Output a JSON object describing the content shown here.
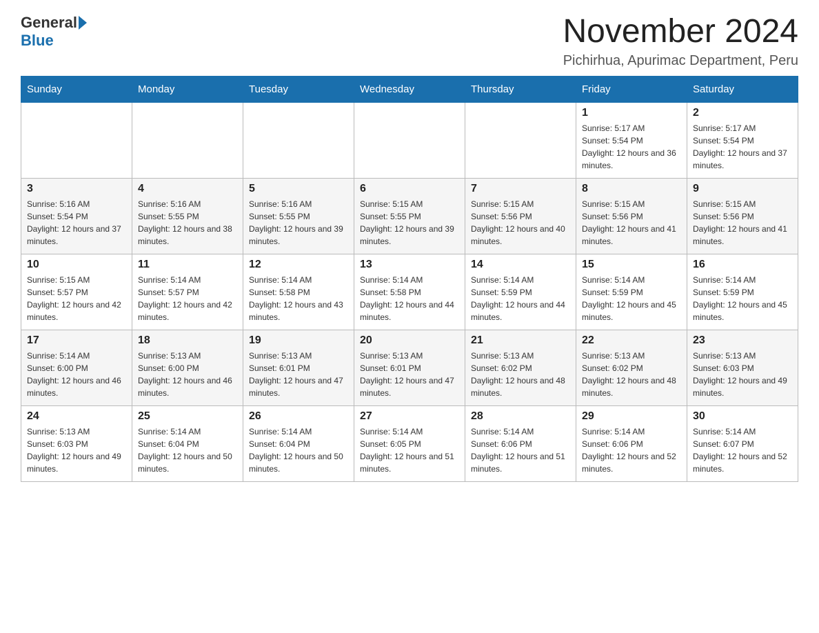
{
  "header": {
    "logo_general": "General",
    "logo_blue": "Blue",
    "month_title": "November 2024",
    "location": "Pichirhua, Apurimac Department, Peru"
  },
  "weekdays": [
    "Sunday",
    "Monday",
    "Tuesday",
    "Wednesday",
    "Thursday",
    "Friday",
    "Saturday"
  ],
  "weeks": [
    [
      {
        "day": "",
        "sunrise": "",
        "sunset": "",
        "daylight": ""
      },
      {
        "day": "",
        "sunrise": "",
        "sunset": "",
        "daylight": ""
      },
      {
        "day": "",
        "sunrise": "",
        "sunset": "",
        "daylight": ""
      },
      {
        "day": "",
        "sunrise": "",
        "sunset": "",
        "daylight": ""
      },
      {
        "day": "",
        "sunrise": "",
        "sunset": "",
        "daylight": ""
      },
      {
        "day": "1",
        "sunrise": "Sunrise: 5:17 AM",
        "sunset": "Sunset: 5:54 PM",
        "daylight": "Daylight: 12 hours and 36 minutes."
      },
      {
        "day": "2",
        "sunrise": "Sunrise: 5:17 AM",
        "sunset": "Sunset: 5:54 PM",
        "daylight": "Daylight: 12 hours and 37 minutes."
      }
    ],
    [
      {
        "day": "3",
        "sunrise": "Sunrise: 5:16 AM",
        "sunset": "Sunset: 5:54 PM",
        "daylight": "Daylight: 12 hours and 37 minutes."
      },
      {
        "day": "4",
        "sunrise": "Sunrise: 5:16 AM",
        "sunset": "Sunset: 5:55 PM",
        "daylight": "Daylight: 12 hours and 38 minutes."
      },
      {
        "day": "5",
        "sunrise": "Sunrise: 5:16 AM",
        "sunset": "Sunset: 5:55 PM",
        "daylight": "Daylight: 12 hours and 39 minutes."
      },
      {
        "day": "6",
        "sunrise": "Sunrise: 5:15 AM",
        "sunset": "Sunset: 5:55 PM",
        "daylight": "Daylight: 12 hours and 39 minutes."
      },
      {
        "day": "7",
        "sunrise": "Sunrise: 5:15 AM",
        "sunset": "Sunset: 5:56 PM",
        "daylight": "Daylight: 12 hours and 40 minutes."
      },
      {
        "day": "8",
        "sunrise": "Sunrise: 5:15 AM",
        "sunset": "Sunset: 5:56 PM",
        "daylight": "Daylight: 12 hours and 41 minutes."
      },
      {
        "day": "9",
        "sunrise": "Sunrise: 5:15 AM",
        "sunset": "Sunset: 5:56 PM",
        "daylight": "Daylight: 12 hours and 41 minutes."
      }
    ],
    [
      {
        "day": "10",
        "sunrise": "Sunrise: 5:15 AM",
        "sunset": "Sunset: 5:57 PM",
        "daylight": "Daylight: 12 hours and 42 minutes."
      },
      {
        "day": "11",
        "sunrise": "Sunrise: 5:14 AM",
        "sunset": "Sunset: 5:57 PM",
        "daylight": "Daylight: 12 hours and 42 minutes."
      },
      {
        "day": "12",
        "sunrise": "Sunrise: 5:14 AM",
        "sunset": "Sunset: 5:58 PM",
        "daylight": "Daylight: 12 hours and 43 minutes."
      },
      {
        "day": "13",
        "sunrise": "Sunrise: 5:14 AM",
        "sunset": "Sunset: 5:58 PM",
        "daylight": "Daylight: 12 hours and 44 minutes."
      },
      {
        "day": "14",
        "sunrise": "Sunrise: 5:14 AM",
        "sunset": "Sunset: 5:59 PM",
        "daylight": "Daylight: 12 hours and 44 minutes."
      },
      {
        "day": "15",
        "sunrise": "Sunrise: 5:14 AM",
        "sunset": "Sunset: 5:59 PM",
        "daylight": "Daylight: 12 hours and 45 minutes."
      },
      {
        "day": "16",
        "sunrise": "Sunrise: 5:14 AM",
        "sunset": "Sunset: 5:59 PM",
        "daylight": "Daylight: 12 hours and 45 minutes."
      }
    ],
    [
      {
        "day": "17",
        "sunrise": "Sunrise: 5:14 AM",
        "sunset": "Sunset: 6:00 PM",
        "daylight": "Daylight: 12 hours and 46 minutes."
      },
      {
        "day": "18",
        "sunrise": "Sunrise: 5:13 AM",
        "sunset": "Sunset: 6:00 PM",
        "daylight": "Daylight: 12 hours and 46 minutes."
      },
      {
        "day": "19",
        "sunrise": "Sunrise: 5:13 AM",
        "sunset": "Sunset: 6:01 PM",
        "daylight": "Daylight: 12 hours and 47 minutes."
      },
      {
        "day": "20",
        "sunrise": "Sunrise: 5:13 AM",
        "sunset": "Sunset: 6:01 PM",
        "daylight": "Daylight: 12 hours and 47 minutes."
      },
      {
        "day": "21",
        "sunrise": "Sunrise: 5:13 AM",
        "sunset": "Sunset: 6:02 PM",
        "daylight": "Daylight: 12 hours and 48 minutes."
      },
      {
        "day": "22",
        "sunrise": "Sunrise: 5:13 AM",
        "sunset": "Sunset: 6:02 PM",
        "daylight": "Daylight: 12 hours and 48 minutes."
      },
      {
        "day": "23",
        "sunrise": "Sunrise: 5:13 AM",
        "sunset": "Sunset: 6:03 PM",
        "daylight": "Daylight: 12 hours and 49 minutes."
      }
    ],
    [
      {
        "day": "24",
        "sunrise": "Sunrise: 5:13 AM",
        "sunset": "Sunset: 6:03 PM",
        "daylight": "Daylight: 12 hours and 49 minutes."
      },
      {
        "day": "25",
        "sunrise": "Sunrise: 5:14 AM",
        "sunset": "Sunset: 6:04 PM",
        "daylight": "Daylight: 12 hours and 50 minutes."
      },
      {
        "day": "26",
        "sunrise": "Sunrise: 5:14 AM",
        "sunset": "Sunset: 6:04 PM",
        "daylight": "Daylight: 12 hours and 50 minutes."
      },
      {
        "day": "27",
        "sunrise": "Sunrise: 5:14 AM",
        "sunset": "Sunset: 6:05 PM",
        "daylight": "Daylight: 12 hours and 51 minutes."
      },
      {
        "day": "28",
        "sunrise": "Sunrise: 5:14 AM",
        "sunset": "Sunset: 6:06 PM",
        "daylight": "Daylight: 12 hours and 51 minutes."
      },
      {
        "day": "29",
        "sunrise": "Sunrise: 5:14 AM",
        "sunset": "Sunset: 6:06 PM",
        "daylight": "Daylight: 12 hours and 52 minutes."
      },
      {
        "day": "30",
        "sunrise": "Sunrise: 5:14 AM",
        "sunset": "Sunset: 6:07 PM",
        "daylight": "Daylight: 12 hours and 52 minutes."
      }
    ]
  ]
}
